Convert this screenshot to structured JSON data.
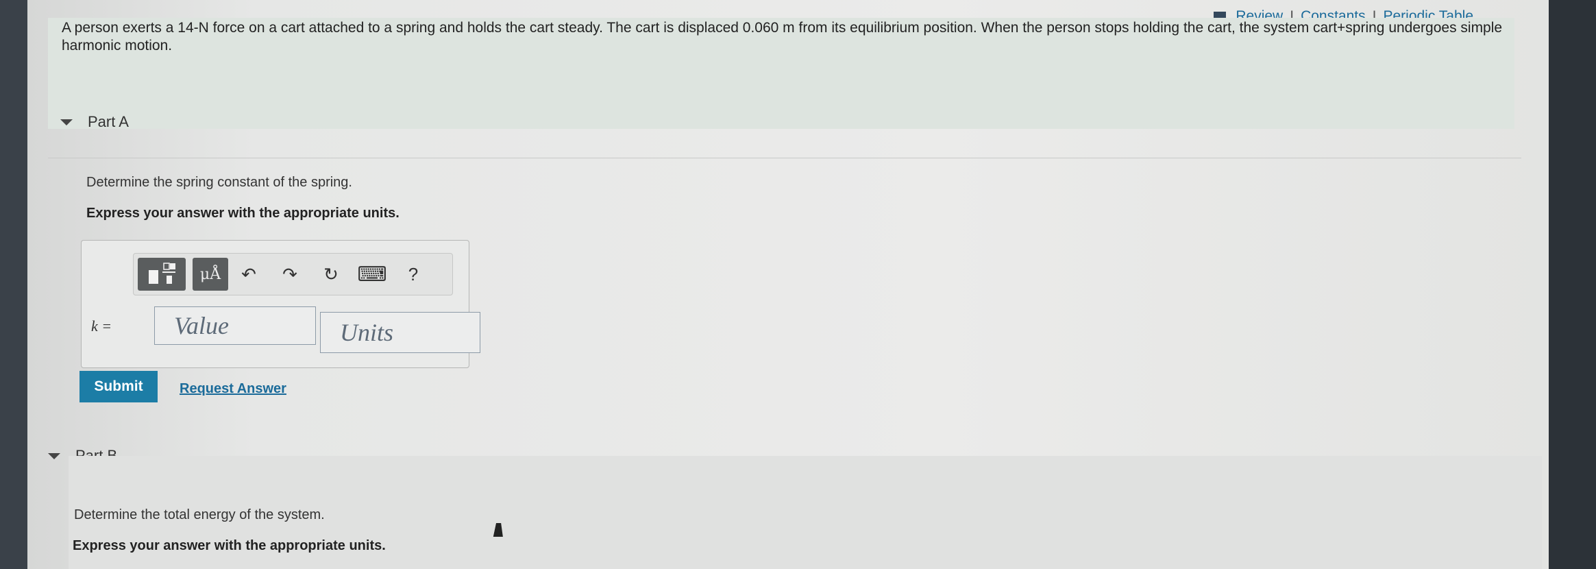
{
  "toplinks": {
    "review": "Review",
    "sep1": "I",
    "constants": "Constants",
    "sep2": "I",
    "periodic": "Periodic Table"
  },
  "intro": {
    "line1": "A person exerts a 14-N force on a cart attached to a spring and holds the cart steady. The cart is displaced 0.060 m from its equilibrium position. When the person stops holding the cart, the system cart+spring undergoes simple",
    "line2": "harmonic motion."
  },
  "partA": {
    "title": "Part A",
    "question": "Determine the spring constant of the spring.",
    "instruction": "Express your answer with the appropriate units.",
    "toolbar": {
      "templates_icon": "templates-icon",
      "units_label": "μÅ",
      "undo": "↶",
      "redo": "↷",
      "reset": "↻",
      "keyboard": "⌨",
      "help": "?"
    },
    "variable": "k =",
    "value_placeholder": "Value",
    "units_placeholder": "Units",
    "submit_label": "Submit",
    "request_label": "Request Answer"
  },
  "partB": {
    "title": "Part B",
    "question": "Determine the total energy of the system.",
    "instruction": "Express your answer with the appropriate units."
  }
}
